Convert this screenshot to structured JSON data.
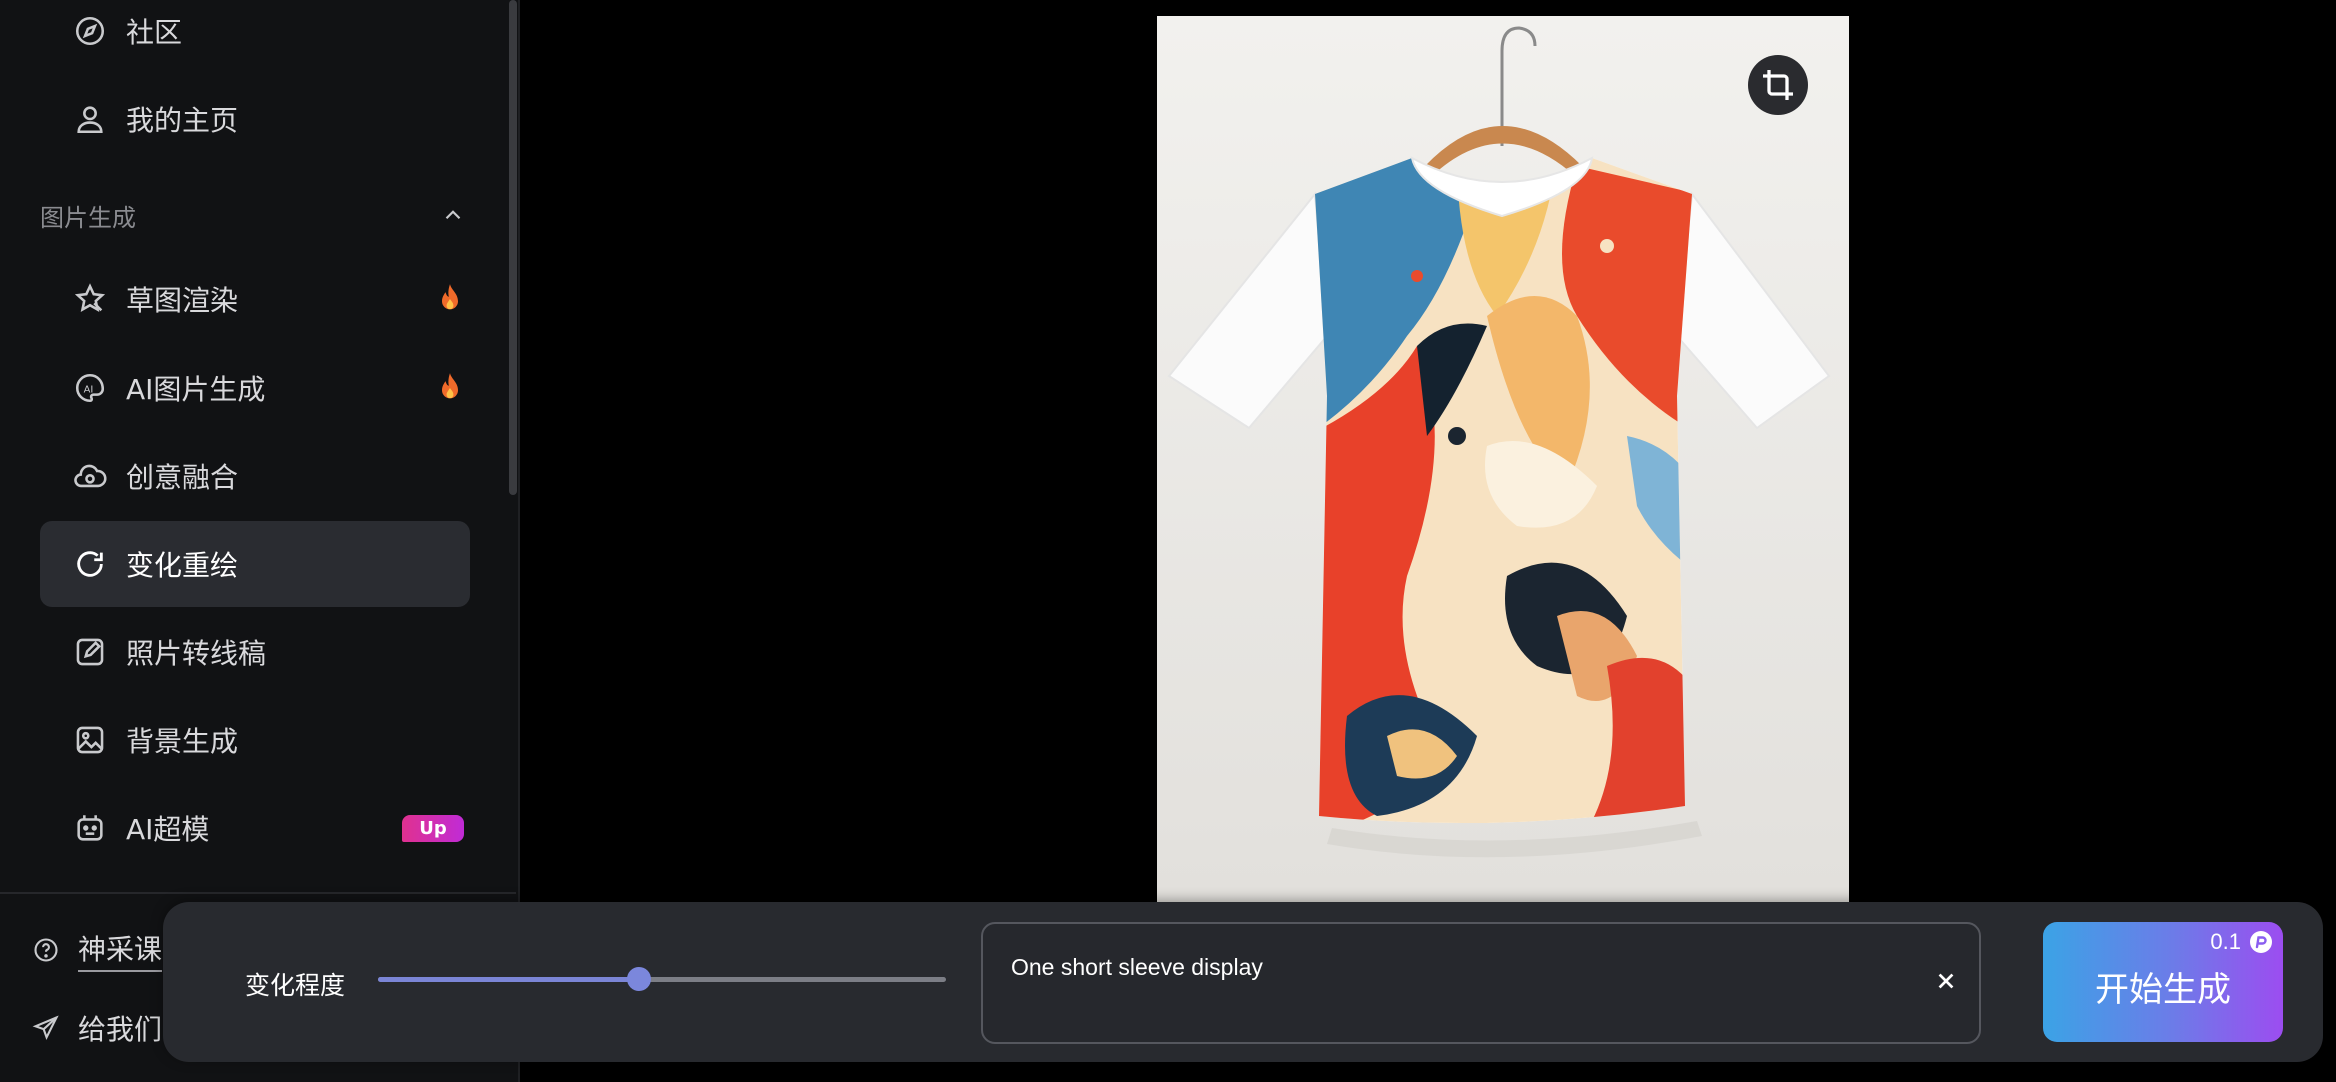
{
  "sidebar": {
    "top_items": [
      {
        "label": "社区",
        "icon": "compass-icon"
      },
      {
        "label": "我的主页",
        "icon": "user-icon"
      }
    ],
    "section": {
      "title": "图片生成",
      "collapse_icon": "chevron-up-icon"
    },
    "items": [
      {
        "label": "草图渲染",
        "icon": "sketch-star-icon",
        "badge": "fire-icon"
      },
      {
        "label": "AI图片生成",
        "icon": "ai-palette-icon",
        "badge": "fire-icon"
      },
      {
        "label": "创意融合",
        "icon": "blend-icon"
      },
      {
        "label": "变化重绘",
        "icon": "refresh-icon",
        "active": true
      },
      {
        "label": "照片转线稿",
        "icon": "edit-square-icon"
      },
      {
        "label": "背景生成",
        "icon": "image-icon"
      },
      {
        "label": "AI超模",
        "icon": "model-icon",
        "badge_text": "Up"
      }
    ],
    "footer": [
      {
        "label": "神采课",
        "icon": "help-circle-icon"
      },
      {
        "label": "给我们",
        "icon": "send-icon"
      }
    ]
  },
  "preview": {
    "alt": "",
    "crop_icon": "crop-icon"
  },
  "controls": {
    "variation_label": "变化程度",
    "variation_value": 0.46,
    "prompt_text": "One short sleeve display",
    "clear_icon": "close-icon",
    "generate_label": "开始生成",
    "generate_cost": "0.1",
    "cost_icon": "coin-icon"
  },
  "colors": {
    "sidebar_bg": "#111214",
    "active_item_bg": "#2a2c31",
    "bar_bg": "#282a2f",
    "accent_slider": "#7b85d6",
    "generate_gradient_start": "#3ba3e6",
    "generate_gradient_end": "#9c4df0",
    "badge_up": "#d22fb5",
    "fire": "#f06a2a"
  }
}
